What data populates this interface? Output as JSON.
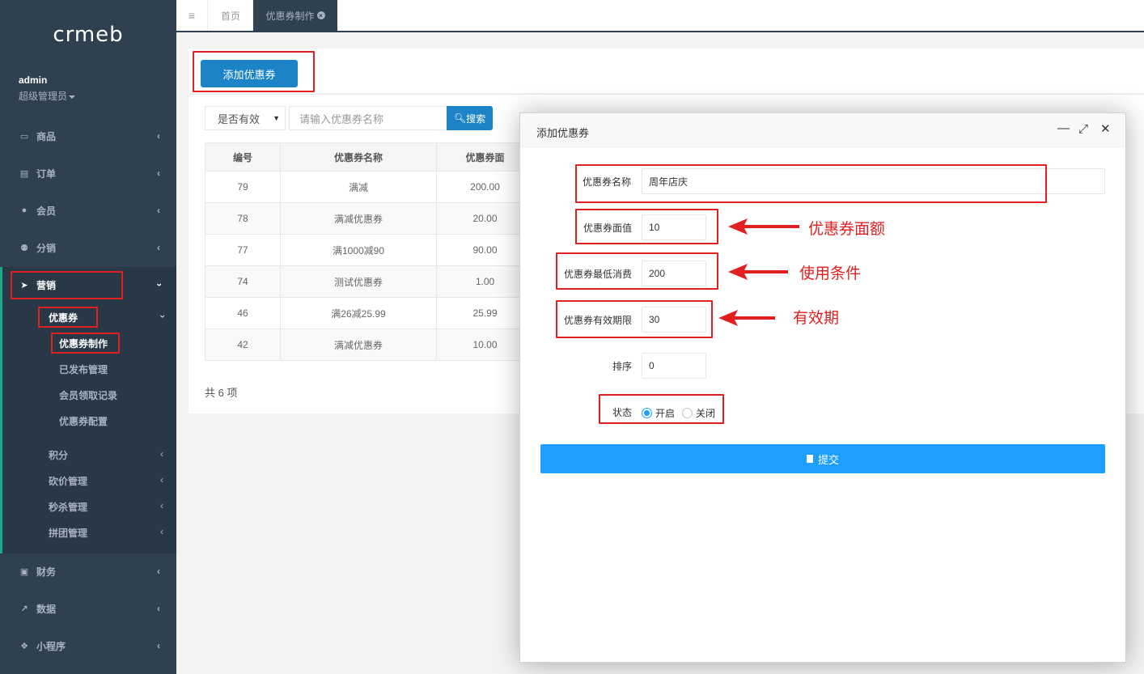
{
  "logo": "crmeb",
  "user": {
    "name": "admin",
    "role": "超级管理员"
  },
  "sidebar": {
    "items": [
      {
        "label": "商品",
        "icon": "laptop-icon"
      },
      {
        "label": "订单",
        "icon": "list-icon"
      },
      {
        "label": "会员",
        "icon": "user-icon"
      },
      {
        "label": "分销",
        "icon": "users-icon"
      },
      {
        "label": "营销",
        "icon": "send-icon"
      },
      {
        "label": "财务",
        "icon": "money-icon"
      },
      {
        "label": "数据",
        "icon": "chart-icon"
      },
      {
        "label": "小程序",
        "icon": "cubes-icon"
      }
    ],
    "marketing_sub": {
      "coupon": "优惠券",
      "coupon_items": [
        "优惠券制作",
        "已发布管理",
        "会员领取记录",
        "优惠券配置"
      ],
      "others": [
        "积分",
        "砍价管理",
        "秒杀管理",
        "拼团管理"
      ]
    }
  },
  "tabs": {
    "home": "首页",
    "active": "优惠券制作"
  },
  "toolbar": {
    "add_button": "添加优惠券"
  },
  "filters": {
    "status_select": "是否有效",
    "search_placeholder": "请输入优惠券名称",
    "search_button": "搜索"
  },
  "table": {
    "headers": [
      "编号",
      "优惠券名称",
      "优惠券面"
    ],
    "rows": [
      [
        "79",
        "满减",
        "200.00"
      ],
      [
        "78",
        "满减优惠券",
        "20.00"
      ],
      [
        "77",
        "满1000减90",
        "90.00"
      ],
      [
        "74",
        "测试优惠券",
        "1.00"
      ],
      [
        "46",
        "满26减25.99",
        "25.99"
      ],
      [
        "42",
        "满减优惠券",
        "10.00"
      ]
    ],
    "total": "共 6 项"
  },
  "modal": {
    "title": "添加优惠券",
    "fields": {
      "name_label": "优惠券名称",
      "name_value": "周年店庆",
      "face_label": "优惠券面值",
      "face_value": "10",
      "min_label": "优惠券最低消费",
      "min_value": "200",
      "period_label": "优惠券有效期限",
      "period_value": "30",
      "sort_label": "排序",
      "sort_value": "0",
      "status_label": "状态",
      "status_on": "开启",
      "status_off": "关闭"
    },
    "submit": "提交"
  },
  "annotations": {
    "face": "优惠券面额",
    "condition": "使用条件",
    "validity": "有效期"
  },
  "colors": {
    "sidebar": "#2f4050",
    "primary": "#1c84c6",
    "submit": "#1e9fff",
    "annotation": "#e02020"
  }
}
